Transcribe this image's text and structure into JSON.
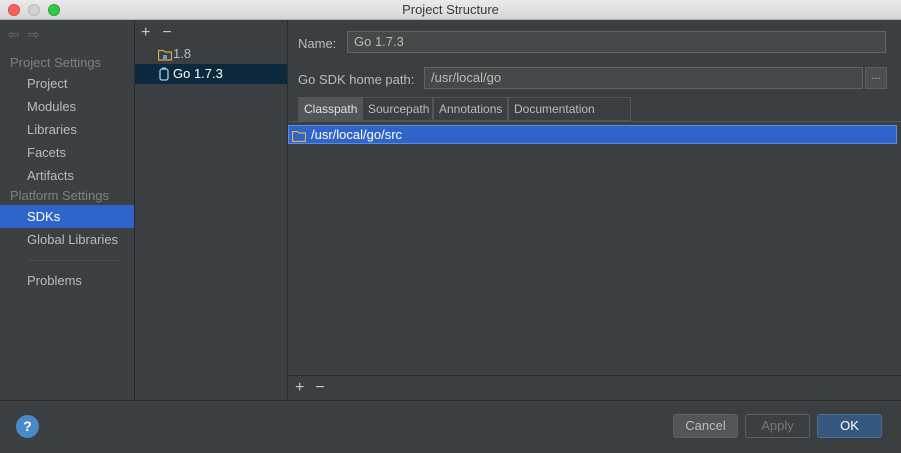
{
  "window": {
    "title": "Project Structure"
  },
  "sidebar": {
    "nav_back": "⇦",
    "nav_forward": "⇨",
    "section_project": "Project Settings",
    "section_platform": "Platform Settings",
    "items": [
      {
        "label": "Project"
      },
      {
        "label": "Modules"
      },
      {
        "label": "Libraries"
      },
      {
        "label": "Facets"
      },
      {
        "label": "Artifacts"
      },
      {
        "label": "SDKs",
        "selected": true
      },
      {
        "label": "Global Libraries"
      },
      {
        "label": "Problems"
      }
    ]
  },
  "sdk_list": {
    "add_label": "+",
    "remove_label": "−",
    "items": [
      {
        "label": "1.8",
        "icon": "folder-java-icon"
      },
      {
        "label": "Go 1.7.3",
        "icon": "go-sdk-icon",
        "selected": true
      }
    ]
  },
  "main": {
    "name_label": "Name:",
    "name_value": "Go 1.7.3",
    "home_label": "Go SDK home path:",
    "home_value": "/usr/local/go",
    "browse_label": "...",
    "tabs": [
      {
        "label": "Classpath",
        "active": true
      },
      {
        "label": "Sourcepath"
      },
      {
        "label": "Annotations"
      },
      {
        "label": "Documentation Paths"
      }
    ],
    "paths": [
      "/usr/local/go/src"
    ],
    "add_label": "+",
    "remove_label": "−"
  },
  "footer": {
    "help_label": "?",
    "cancel_label": "Cancel",
    "apply_label": "Apply",
    "ok_label": "OK"
  },
  "colors": {
    "selection": "#2f65ca",
    "ok_button": "#365880",
    "background": "#3c3f41"
  }
}
